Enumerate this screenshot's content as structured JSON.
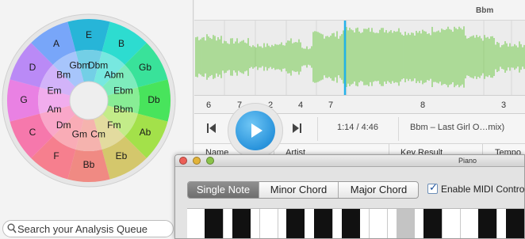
{
  "app": {
    "track_title": "Bbm"
  },
  "key_wheel": {
    "outer_keys": [
      "E",
      "B",
      "Gb",
      "Db",
      "Ab",
      "Eb",
      "Bb",
      "F",
      "C",
      "G",
      "D",
      "A"
    ],
    "inner_keys": [
      "Dbm",
      "Abm",
      "Ebm",
      "Bbm",
      "Fm",
      "Cm",
      "Gm",
      "Dm",
      "Am",
      "Em",
      "Bm",
      "Gbm"
    ],
    "colors": [
      "#27b5d8",
      "#2ddcd0",
      "#39e29a",
      "#48e45c",
      "#a3e14a",
      "#d4c76c",
      "#f08a83",
      "#f67f8e",
      "#f678ac",
      "#e981e3",
      "#ba8af6",
      "#78a6f9"
    ],
    "selected_key": "Bbm"
  },
  "search": {
    "placeholder": "Search your Analysis Queue",
    "icon": "search-icon"
  },
  "waveform": {
    "color": "#8ad16a",
    "playhead_color": "#23b2ea"
  },
  "ruler": {
    "markers": [
      "6",
      "7",
      "2",
      "4",
      "7",
      "8",
      "3"
    ]
  },
  "transport": {
    "time": "1:14 / 4:46",
    "now_playing": "Bbm – Last Girl O…mix)",
    "prev_icon": "skip-back-icon",
    "play_icon": "play-icon",
    "next_icon": "skip-forward-icon"
  },
  "table": {
    "headers": [
      "Name",
      "Artist",
      "Key Result",
      "Tempo"
    ]
  },
  "piano": {
    "title": "Piano",
    "modes": [
      "Single Note",
      "Minor Chord",
      "Major Chord"
    ],
    "selected_mode": "Single Note",
    "midi_label": "Enable MIDI Control",
    "midi_enabled": true,
    "highlighted_note": "G#"
  }
}
